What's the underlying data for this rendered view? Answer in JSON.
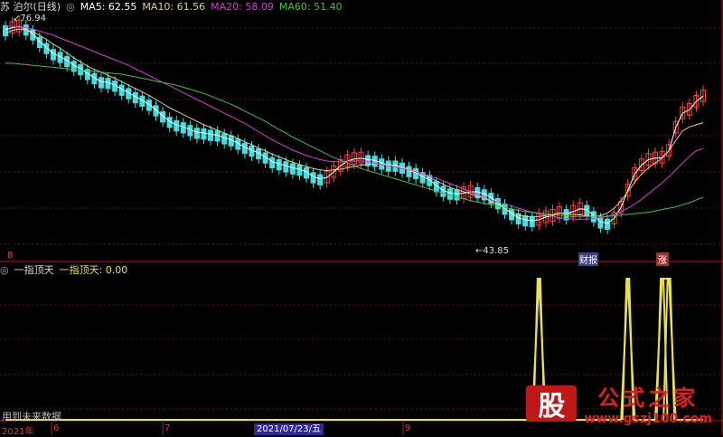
{
  "header": {
    "title": "苏 泊尔(日线)",
    "ma5": "MA5: 62.55",
    "ma10": "MA10: 61.56",
    "ma20": "MA20: 58.09",
    "ma60": "MA60: 51.40"
  },
  "indicator": {
    "name": "一指顶天",
    "value_label": "一指顶天: 0.00"
  },
  "annotations": {
    "high_label": "76.94",
    "low_label": "43.85",
    "caibao_label": "财报",
    "zhang_label": "涨",
    "marker_8": "8",
    "bottom_note": "用到未来数据"
  },
  "axis": {
    "year_label": "2021年",
    "months": [
      "6",
      "7",
      "9"
    ],
    "cursor_date": "2021/07/23/五"
  },
  "watermark": {
    "logo_char": "股",
    "brand": "公式之家",
    "url": "www.gszj100.com"
  },
  "colors": {
    "up": "#ff4040",
    "down": "#40e0e0",
    "ma5": "#ffffff",
    "ma10": "#e0d080",
    "ma20": "#d040d0",
    "ma60": "#40c040",
    "indicator": "#e8e050",
    "grid": "#6a1010"
  },
  "chart_data": [
    {
      "type": "line",
      "title": "苏 泊尔(日线)",
      "ylim": [
        42,
        78
      ],
      "series": [
        {
          "name": "MA5",
          "values": [
            75.5,
            75.8,
            76.0,
            75.6,
            74.9,
            73.8,
            72.9,
            72.0,
            71.6,
            71.0,
            70.3,
            69.8,
            69.1,
            68.5,
            67.9,
            67.8,
            67.4,
            66.8,
            66.3,
            65.7,
            65.2,
            64.6,
            63.8,
            62.9,
            62.1,
            61.6,
            61.3,
            60.9,
            60.5,
            60.4,
            60.2,
            60.1,
            59.7,
            59.4,
            58.9,
            58.3,
            57.9,
            57.5,
            56.9,
            56.2,
            55.9,
            55.6,
            55.3,
            55.1,
            54.7,
            54.0,
            53.7,
            53.9,
            54.7,
            55.6,
            56.3,
            56.6,
            56.7,
            56.5,
            56.4,
            56.0,
            55.7,
            55.7,
            55.4,
            54.9,
            54.6,
            54.0,
            53.6,
            52.7,
            52.0,
            51.6,
            51.5,
            51.6,
            51.8,
            51.8,
            51.5,
            51.0,
            50.2,
            49.4,
            48.6,
            48.0,
            47.7,
            47.6,
            47.7,
            48.1,
            48.3,
            48.7,
            48.6,
            48.9,
            49.3,
            49.2,
            48.3,
            47.4,
            47.2,
            47.9,
            49.5,
            52.0,
            54.4,
            55.7,
            56.5,
            56.7,
            56.8,
            57.8,
            61.2,
            63.3,
            63.8,
            65.0,
            65.8
          ]
        },
        {
          "name": "MA10",
          "values": [
            75.0,
            75.4,
            75.6,
            75.5,
            75.2,
            74.7,
            74.1,
            73.4,
            72.8,
            72.1,
            71.4,
            70.8,
            70.2,
            69.7,
            69.3,
            68.8,
            68.4,
            67.9,
            67.4,
            66.9,
            66.4,
            65.9,
            65.3,
            64.7,
            64.1,
            63.6,
            63.1,
            62.6,
            62.1,
            61.6,
            61.2,
            60.8,
            60.4,
            60.0,
            59.6,
            59.1,
            58.7,
            58.2,
            57.8,
            57.3,
            56.9,
            56.5,
            56.1,
            55.8,
            55.5,
            55.2,
            55.0,
            54.9,
            55.0,
            55.1,
            55.3,
            55.5,
            55.7,
            55.8,
            55.9,
            55.9,
            55.8,
            55.6,
            55.4,
            55.1,
            54.8,
            54.4,
            53.9,
            53.4,
            52.9,
            52.4,
            52.1,
            51.8,
            51.5,
            51.2,
            50.9,
            50.4,
            49.9,
            49.3,
            48.8,
            48.4,
            48.2,
            48.1,
            48.2,
            48.3,
            48.5,
            48.7,
            48.6,
            48.5,
            48.4,
            48.3,
            48.2,
            48.3,
            48.7,
            49.4,
            50.5,
            51.8,
            53.2,
            54.4,
            55.3,
            56.0,
            56.7,
            57.8,
            59.3,
            60.7,
            61.3,
            61.6,
            61.9
          ]
        },
        {
          "name": "MA20",
          "values": [
            76.0,
            76.0,
            75.9,
            75.8,
            75.6,
            75.3,
            75.0,
            74.7,
            74.3,
            73.9,
            73.5,
            73.1,
            72.7,
            72.3,
            71.9,
            71.5,
            71.1,
            70.7,
            70.3,
            69.8,
            69.3,
            68.8,
            68.3,
            67.8,
            67.3,
            66.8,
            66.3,
            65.8,
            65.3,
            64.8,
            64.3,
            63.8,
            63.3,
            62.8,
            62.3,
            61.8,
            61.2,
            60.6,
            60.0,
            59.4,
            58.9,
            58.4,
            57.9,
            57.5,
            57.1,
            56.8,
            56.5,
            56.3,
            56.2,
            56.2,
            56.3,
            56.3,
            56.3,
            56.2,
            56.0,
            55.8,
            55.6,
            55.4,
            55.2,
            55.0,
            54.7,
            54.4,
            54.1,
            53.8,
            53.4,
            53.0,
            52.6,
            52.2,
            51.8,
            51.4,
            51.0,
            50.6,
            50.3,
            50.0,
            49.7,
            49.4,
            49.1,
            48.8,
            48.6,
            48.4,
            48.2,
            48.0,
            47.9,
            47.8,
            47.8,
            47.8,
            47.9,
            48.0,
            48.2,
            48.5,
            48.9,
            49.4,
            50.0,
            50.7,
            51.5,
            52.3,
            53.1,
            54.0,
            55.0,
            56.0,
            57.0,
            57.8,
            58.1
          ]
        },
        {
          "name": "MA60",
          "values": [
            70.6,
            70.6,
            70.5,
            70.4,
            70.3,
            70.2,
            70.1,
            70.0,
            69.9,
            69.8,
            69.7,
            69.6,
            69.5,
            69.4,
            69.3,
            69.2,
            69.1,
            69.0,
            68.8,
            68.6,
            68.4,
            68.2,
            68.0,
            67.8,
            67.6,
            67.4,
            67.1,
            66.8,
            66.5,
            66.2,
            65.8,
            65.4,
            65.0,
            64.6,
            64.1,
            63.6,
            63.1,
            62.6,
            62.1,
            61.5,
            60.9,
            60.4,
            59.8,
            59.3,
            58.8,
            58.3,
            57.8,
            57.3,
            56.8,
            56.4,
            56.0,
            55.6,
            55.2,
            54.9,
            54.6,
            54.3,
            54.0,
            53.7,
            53.4,
            53.1,
            52.8,
            52.5,
            52.2,
            51.9,
            51.6,
            51.3,
            51.0,
            50.8,
            50.5,
            50.3,
            50.1,
            49.9,
            49.7,
            49.5,
            49.3,
            49.1,
            48.9,
            48.8,
            48.7,
            48.6,
            48.5,
            48.4,
            48.3,
            48.2,
            48.2,
            48.2,
            48.2,
            48.2,
            48.2,
            48.3,
            48.4,
            48.5,
            48.6,
            48.7,
            48.8,
            49.0,
            49.2,
            49.4,
            49.6,
            49.9,
            50.2,
            50.6,
            51.0
          ]
        }
      ],
      "annotations": {
        "high": 76.94,
        "low": 43.85
      }
    },
    {
      "type": "line",
      "title": "一指顶天",
      "series": [
        {
          "name": "一指顶天",
          "values": [
            0,
            0,
            0,
            0,
            0,
            0,
            0,
            0,
            0,
            0,
            0,
            0,
            0,
            0,
            0,
            0,
            0,
            0,
            0,
            0,
            0,
            0,
            0,
            0,
            0,
            0,
            0,
            0,
            0,
            0,
            0,
            0,
            0,
            0,
            0,
            0,
            0,
            0,
            0,
            0,
            0,
            0,
            0,
            0,
            0,
            0,
            0,
            0,
            0,
            0,
            0,
            0,
            0,
            0,
            0,
            0,
            0,
            0,
            0,
            0,
            0,
            0,
            0,
            0,
            0,
            0,
            0,
            0,
            0,
            0,
            0,
            0,
            0,
            0,
            0,
            0,
            0,
            0,
            1,
            0,
            0,
            0,
            0,
            0,
            0,
            0,
            0,
            0,
            0,
            0,
            0,
            1,
            0,
            0,
            0,
            0,
            1,
            1,
            0,
            0,
            0,
            0,
            0
          ]
        }
      ],
      "ylim": [
        0,
        1
      ]
    }
  ]
}
